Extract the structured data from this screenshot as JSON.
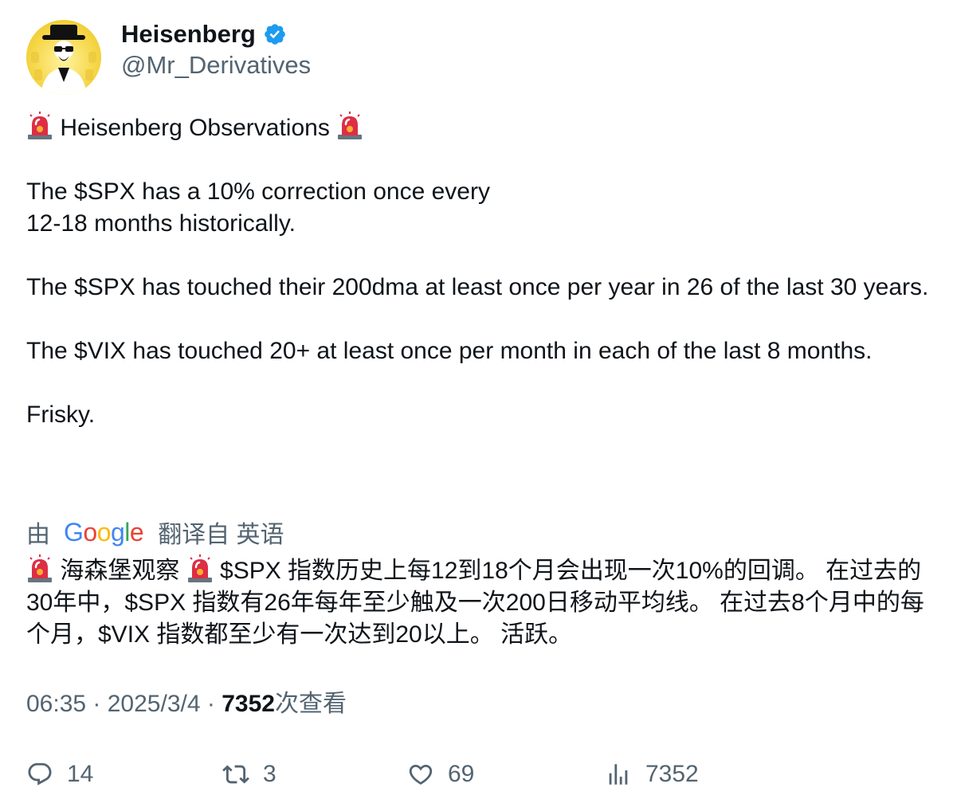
{
  "author": {
    "display_name": "Heisenberg",
    "handle": "@Mr_Derivatives",
    "verified_icon": "verified-badge-icon",
    "avatar_icon": "heisenberg-avatar"
  },
  "tweet": {
    "title_line": " Heisenberg Observations ",
    "para1_line1": "The $SPX has a 10% correction once every",
    "para1_line2": "12-18 months historically.",
    "para2": "The $SPX has touched their 200dma at least once per year in 26 of the last 30 years.",
    "para3": "The $VIX has touched 20+ at least once per month in each of the last 8 months.",
    "para4": "Frisky.",
    "emoji": "police-light-siren"
  },
  "translation": {
    "prefix": "由",
    "provider": "Google",
    "suffix": "翻译自 英语",
    "text_part1": " 海森堡观察 ",
    "text_part2": " $SPX 指数历史上每12到18个月会出现一次10%的回调。 在过去的30年中，$SPX 指数有26年每年至少触及一次200日移动平均线。 在过去8个月中的每个月，$VIX 指数都至少有一次达到20以上。 活跃。"
  },
  "meta": {
    "time": "06:35",
    "separator": " · ",
    "date": "2025/3/4",
    "views_count": "7352",
    "views_label": "次查看"
  },
  "actions": {
    "replies": "14",
    "reposts": "3",
    "likes": "69",
    "views": "7352"
  },
  "colors": {
    "text_primary": "#0f1419",
    "text_secondary": "#536471",
    "verified_blue": "#1d9bf0",
    "avatar_yellow": "#f6d84a"
  }
}
